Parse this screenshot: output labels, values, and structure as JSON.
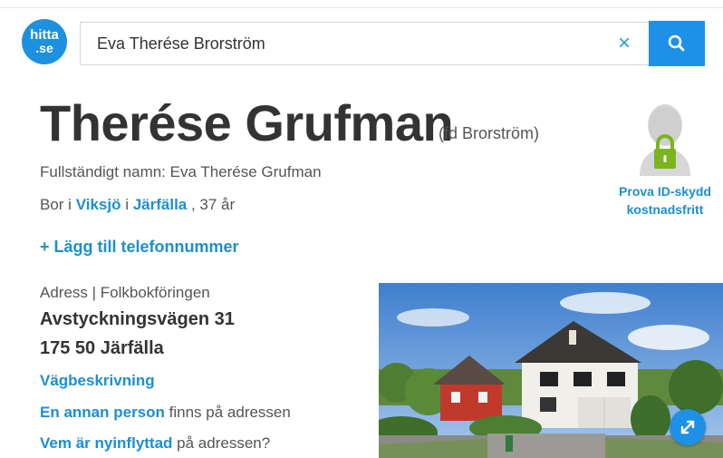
{
  "header": {
    "logo_line1": "hitta",
    "logo_line2": ".se",
    "search_value": "Eva Therése Brorström",
    "clear_symbol": "×",
    "search_icon": "search-icon",
    "brand_color": "#1e90e8"
  },
  "person": {
    "name": "Therése Grufman",
    "former_name": "(fd Brorström)",
    "fullname_text": "Fullständigt namn: Eva Therése Grufman",
    "lives_prefix": "Bor i ",
    "district": "Viksjö",
    "lives_mid": " i ",
    "municipality": "Järfälla",
    "age_text": " , 37 år",
    "add_phone": "+ Lägg till telefonnummer"
  },
  "id_protect": {
    "line1": "Prova ID-skydd",
    "line2": "kostnadsfritt",
    "icon": "padlock-person-icon",
    "lock_color": "#7ab520"
  },
  "address": {
    "label": "Adress | Folkbokföringen",
    "street": "Avstyckningsvägen 31",
    "zip_city": "175 50 Järfälla",
    "directions": "Vägbeskrivning",
    "other_link": "En annan person",
    "other_rest": " finns på adressen",
    "moved_link": "Vem är nyinflyttad",
    "moved_rest": " på adressen?"
  },
  "photo": {
    "expand_icon": "expand-arrows-icon"
  }
}
